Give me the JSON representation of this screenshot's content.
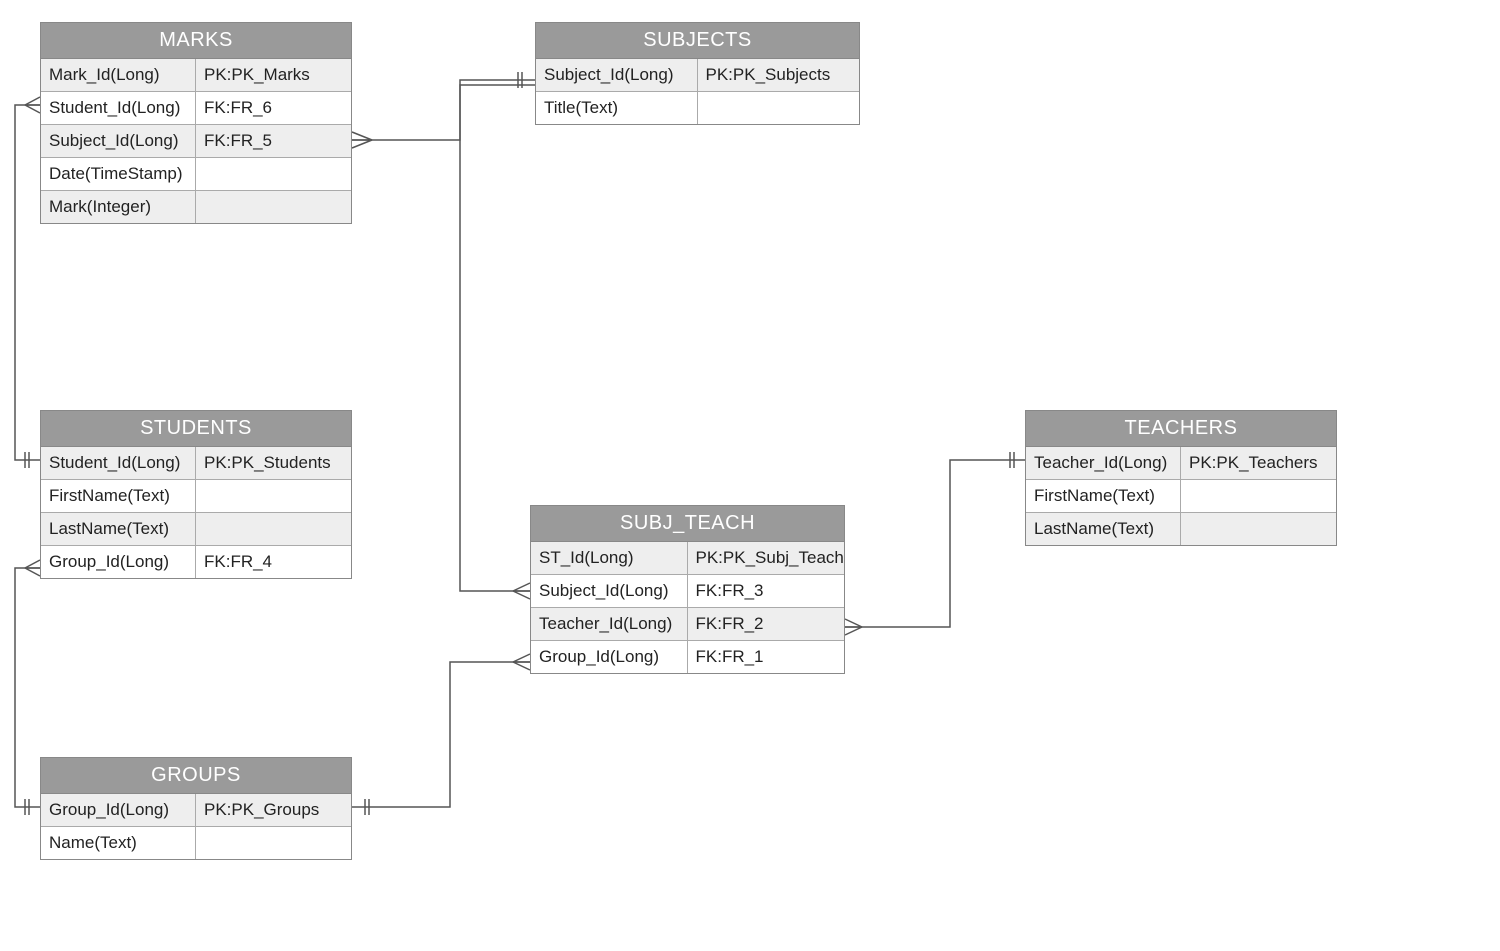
{
  "entities": {
    "marks": {
      "title": "MARKS",
      "rows": [
        {
          "field": "Mark_Id(Long)",
          "key": "PK:PK_Marks",
          "alt": true
        },
        {
          "field": "Student_Id(Long)",
          "key": "FK:FR_6",
          "alt": false
        },
        {
          "field": "Subject_Id(Long)",
          "key": "FK:FR_5",
          "alt": true
        },
        {
          "field": "Date(TimeStamp)",
          "key": "",
          "alt": false
        },
        {
          "field": "Mark(Integer)",
          "key": "",
          "alt": true
        }
      ]
    },
    "subjects": {
      "title": "SUBJECTS",
      "rows": [
        {
          "field": "Subject_Id(Long)",
          "key": "PK:PK_Subjects",
          "alt": true
        },
        {
          "field": "Title(Text)",
          "key": "",
          "alt": false
        }
      ]
    },
    "students": {
      "title": "STUDENTS",
      "rows": [
        {
          "field": "Student_Id(Long)",
          "key": "PK:PK_Students",
          "alt": true
        },
        {
          "field": "FirstName(Text)",
          "key": "",
          "alt": false
        },
        {
          "field": "LastName(Text)",
          "key": "",
          "alt": true
        },
        {
          "field": "Group_Id(Long)",
          "key": "FK:FR_4",
          "alt": false
        }
      ]
    },
    "teachers": {
      "title": "TEACHERS",
      "rows": [
        {
          "field": "Teacher_Id(Long)",
          "key": "PK:PK_Teachers",
          "alt": true
        },
        {
          "field": "FirstName(Text)",
          "key": "",
          "alt": false
        },
        {
          "field": "LastName(Text)",
          "key": "",
          "alt": true
        }
      ]
    },
    "subj_teach": {
      "title": "SUBJ_TEACH",
      "rows": [
        {
          "field": "ST_Id(Long)",
          "key": "PK:PK_Subj_Teach",
          "alt": true
        },
        {
          "field": "Subject_Id(Long)",
          "key": "FK:FR_3",
          "alt": false
        },
        {
          "field": "Teacher_Id(Long)",
          "key": "FK:FR_2",
          "alt": true
        },
        {
          "field": "Group_Id(Long)",
          "key": "FK:FR_1",
          "alt": false
        }
      ]
    },
    "groups": {
      "title": "GROUPS",
      "rows": [
        {
          "field": "Group_Id(Long)",
          "key": "PK:PK_Groups",
          "alt": true
        },
        {
          "field": "Name(Text)",
          "key": "",
          "alt": false
        }
      ]
    }
  }
}
